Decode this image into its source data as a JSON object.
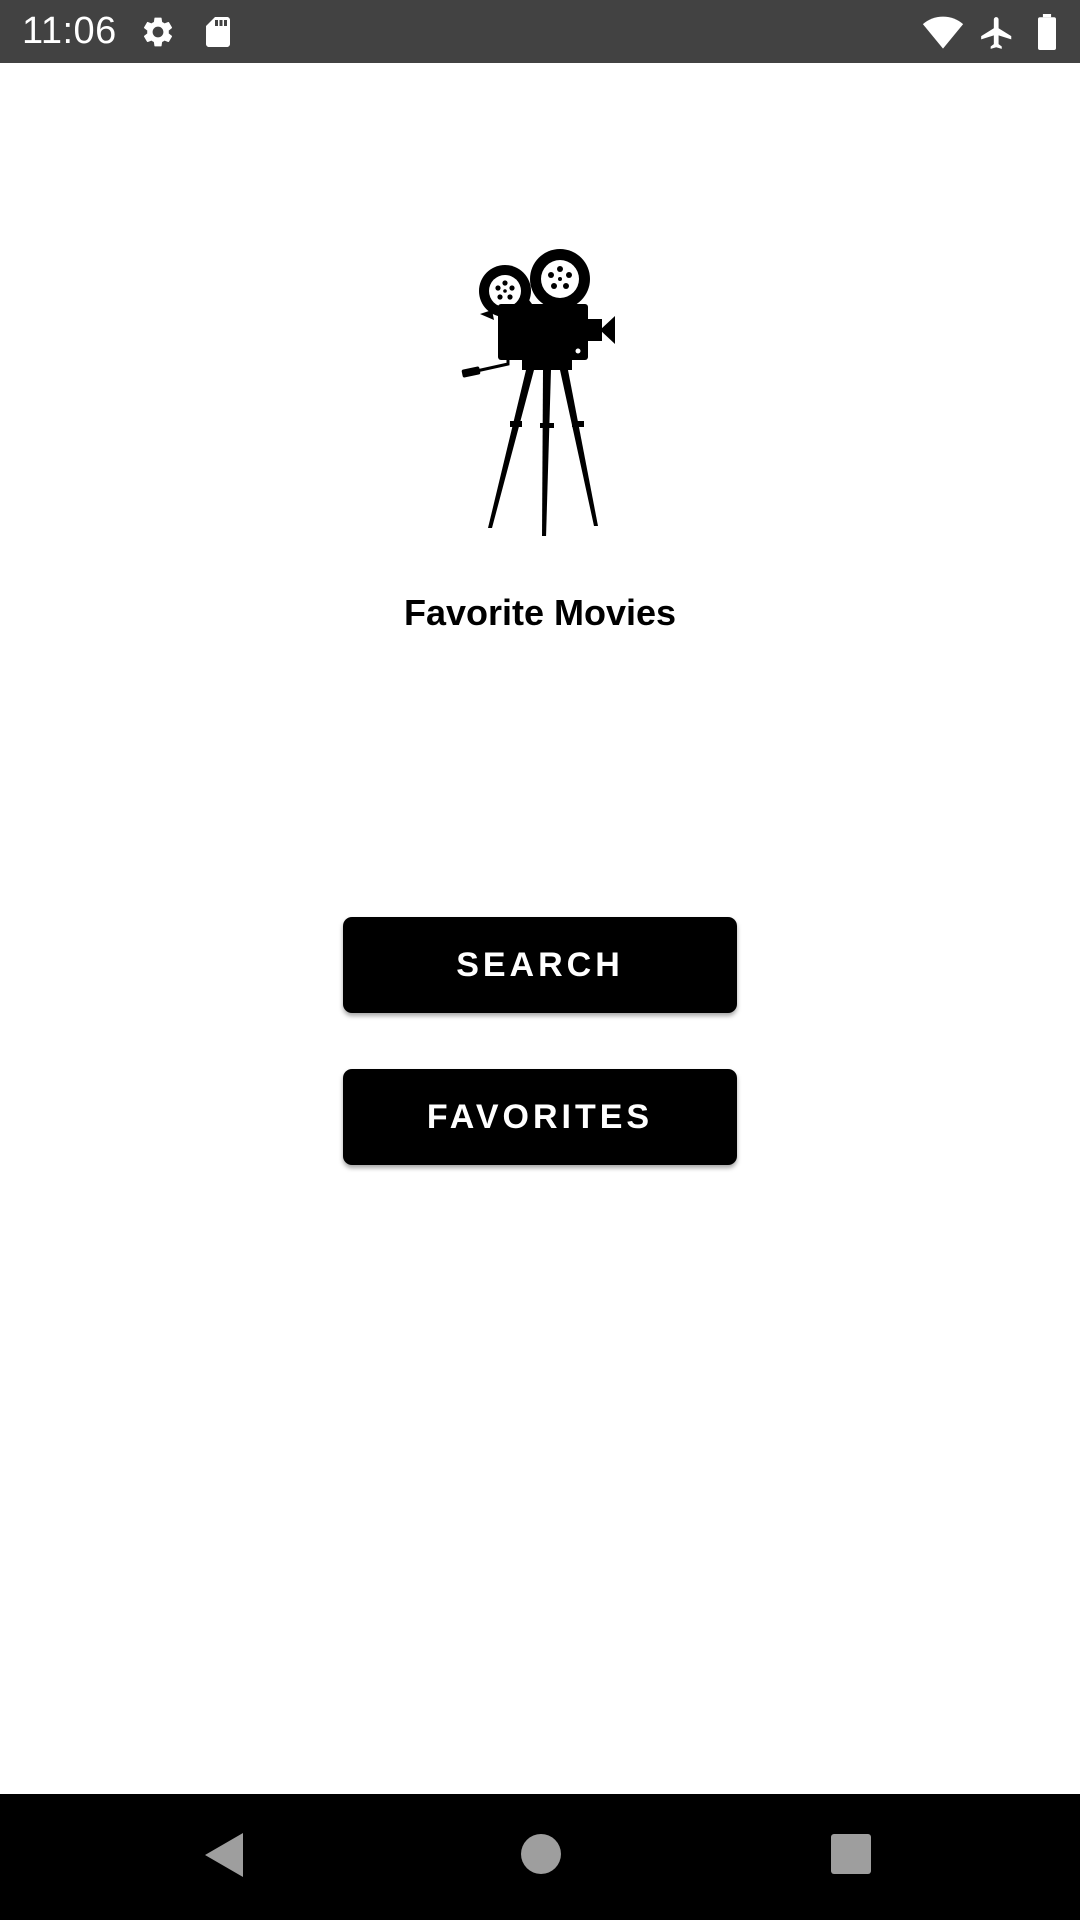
{
  "status_bar": {
    "time": "11:06",
    "left_icons": [
      "settings-icon",
      "sd-card-icon"
    ],
    "right_icons": [
      "wifi-icon",
      "airplane-mode-icon",
      "battery-icon"
    ]
  },
  "app": {
    "logo_icon": "movie-camera-icon",
    "title": "Favorite Movies",
    "buttons": {
      "search_label": "SEARCH",
      "favorites_label": "FAVORITES"
    }
  },
  "nav_bar": {
    "icons": [
      "back-icon",
      "home-icon",
      "recents-icon"
    ]
  },
  "colors": {
    "status_bar_bg": "#424242",
    "background": "#ffffff",
    "button_bg": "#000000",
    "button_text": "#ffffff",
    "nav_bar_bg": "#000000",
    "nav_icon": "#9e9e9e"
  }
}
